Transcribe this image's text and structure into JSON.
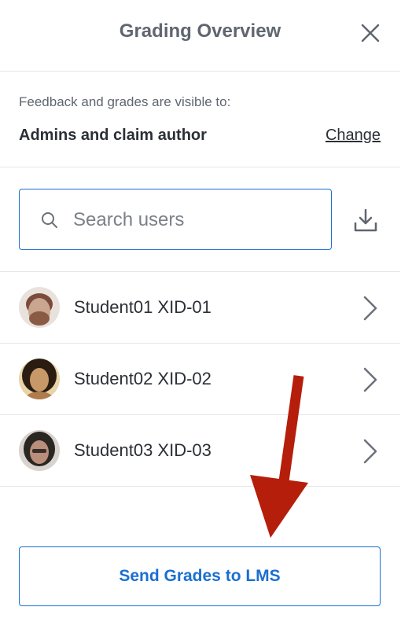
{
  "panel": {
    "title": "Grading Overview",
    "close_icon": "close-icon"
  },
  "visibility": {
    "label": "Feedback and grades are visible to:",
    "value": "Admins and claim author",
    "change_link": "Change"
  },
  "search": {
    "placeholder": "Search users",
    "value": "",
    "search_icon": "search-icon",
    "download_icon": "download-icon"
  },
  "users": [
    {
      "name": "Student01 XID-01",
      "avatar_colors": [
        "#7a4a3a",
        "#caa58f"
      ]
    },
    {
      "name": "Student02 XID-02",
      "avatar_colors": [
        "#2b1c12",
        "#c79868"
      ]
    },
    {
      "name": "Student03 XID-03",
      "avatar_colors": [
        "#2a2622",
        "#b98e7a"
      ]
    }
  ],
  "footer": {
    "send_button": "Send Grades to LMS"
  },
  "colors": {
    "accent": "#1b6fd1",
    "annotation_arrow": "#b51e0b",
    "text": "#2b2f36",
    "muted": "#5f6670",
    "divider": "#e4e6ea"
  }
}
